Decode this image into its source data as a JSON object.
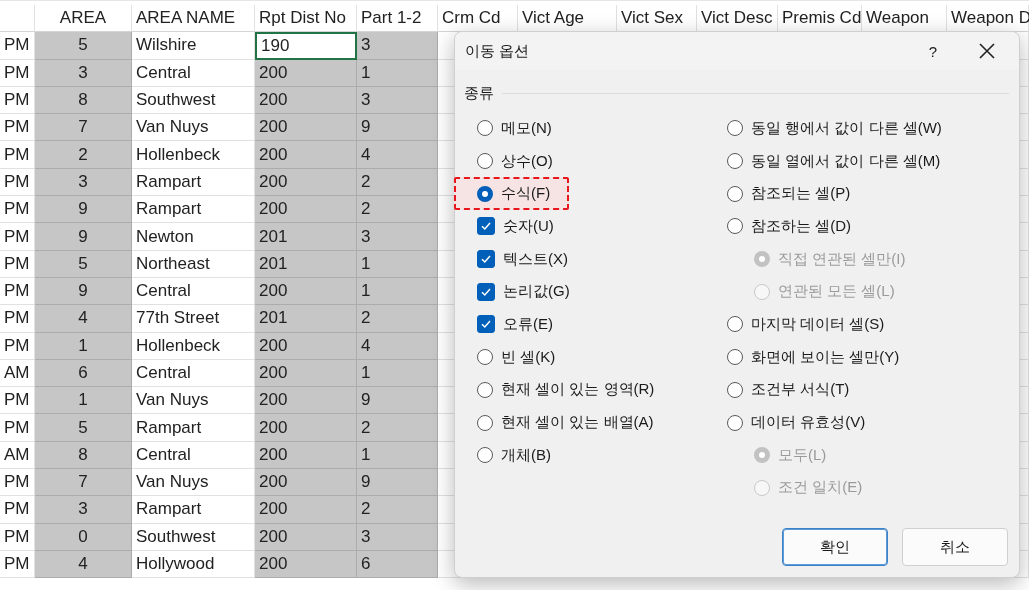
{
  "spreadsheet": {
    "columns": [
      {
        "selected": false
      },
      {
        "heading": "AREA",
        "selected": true
      },
      {
        "heading": "AREA NAME",
        "selected": false
      },
      {
        "heading": "Rpt Dist No",
        "selected": true
      },
      {
        "heading": "Part 1-2",
        "selected": true
      }
    ],
    "covered_columns": [
      {
        "heading": "Crm Cd"
      },
      {
        "heading": "Vict Age"
      },
      {
        "heading": "Vict Sex"
      },
      {
        "heading": "Vict Desc"
      },
      {
        "heading": "Premis Cd"
      },
      {
        "heading": "Weapon"
      },
      {
        "heading": "Weapon D"
      }
    ],
    "rows": [
      {
        "cells": [
          {
            "text": "PM",
            "active": false
          },
          {
            "text": "5",
            "active": false
          },
          {
            "text": "Wilshire",
            "active": false
          },
          {
            "text": "190",
            "active": true
          },
          {
            "text": "3",
            "active": false
          }
        ]
      },
      {
        "cells": [
          {
            "text": "PM",
            "active": false
          },
          {
            "text": "3",
            "active": false
          },
          {
            "text": "Central",
            "active": false
          },
          {
            "text": "200",
            "active": false
          },
          {
            "text": "1",
            "active": false
          }
        ]
      },
      {
        "cells": [
          {
            "text": "PM",
            "active": false
          },
          {
            "text": "8",
            "active": false
          },
          {
            "text": "Southwest",
            "active": false
          },
          {
            "text": "200",
            "active": false
          },
          {
            "text": "3",
            "active": false
          }
        ]
      },
      {
        "cells": [
          {
            "text": "PM",
            "active": false
          },
          {
            "text": "7",
            "active": false
          },
          {
            "text": "Van Nuys",
            "active": false
          },
          {
            "text": "200",
            "active": false
          },
          {
            "text": "9",
            "active": false
          }
        ]
      },
      {
        "cells": [
          {
            "text": "PM",
            "active": false
          },
          {
            "text": "2",
            "active": false
          },
          {
            "text": "Hollenbeck",
            "active": false
          },
          {
            "text": "200",
            "active": false
          },
          {
            "text": "4",
            "active": false
          }
        ]
      },
      {
        "cells": [
          {
            "text": "PM",
            "active": false
          },
          {
            "text": "3",
            "active": false
          },
          {
            "text": "Rampart",
            "active": false
          },
          {
            "text": "200",
            "active": false
          },
          {
            "text": "2",
            "active": false
          }
        ]
      },
      {
        "cells": [
          {
            "text": "PM",
            "active": false
          },
          {
            "text": "9",
            "active": false
          },
          {
            "text": "Rampart",
            "active": false
          },
          {
            "text": "200",
            "active": false
          },
          {
            "text": "2",
            "active": false
          }
        ]
      },
      {
        "cells": [
          {
            "text": "PM",
            "active": false
          },
          {
            "text": "9",
            "active": false
          },
          {
            "text": "Newton",
            "active": false
          },
          {
            "text": "201",
            "active": false
          },
          {
            "text": "3",
            "active": false
          }
        ]
      },
      {
        "cells": [
          {
            "text": "PM",
            "active": false
          },
          {
            "text": "5",
            "active": false
          },
          {
            "text": "Northeast",
            "active": false
          },
          {
            "text": "201",
            "active": false
          },
          {
            "text": "1",
            "active": false
          }
        ]
      },
      {
        "cells": [
          {
            "text": "PM",
            "active": false
          },
          {
            "text": "9",
            "active": false
          },
          {
            "text": "Central",
            "active": false
          },
          {
            "text": "200",
            "active": false
          },
          {
            "text": "1",
            "active": false
          }
        ]
      },
      {
        "cells": [
          {
            "text": "PM",
            "active": false
          },
          {
            "text": "4",
            "active": false
          },
          {
            "text": "77th Street",
            "active": false
          },
          {
            "text": "201",
            "active": false
          },
          {
            "text": "2",
            "active": false
          }
        ]
      },
      {
        "cells": [
          {
            "text": "PM",
            "active": false
          },
          {
            "text": "1",
            "active": false
          },
          {
            "text": "Hollenbeck",
            "active": false
          },
          {
            "text": "200",
            "active": false
          },
          {
            "text": "4",
            "active": false
          }
        ]
      },
      {
        "cells": [
          {
            "text": "AM",
            "active": false
          },
          {
            "text": "6",
            "active": false
          },
          {
            "text": "Central",
            "active": false
          },
          {
            "text": "200",
            "active": false
          },
          {
            "text": "1",
            "active": false
          }
        ]
      },
      {
        "cells": [
          {
            "text": "PM",
            "active": false
          },
          {
            "text": "1",
            "active": false
          },
          {
            "text": "Van Nuys",
            "active": false
          },
          {
            "text": "200",
            "active": false
          },
          {
            "text": "9",
            "active": false
          }
        ]
      },
      {
        "cells": [
          {
            "text": "PM",
            "active": false
          },
          {
            "text": "5",
            "active": false
          },
          {
            "text": "Rampart",
            "active": false
          },
          {
            "text": "200",
            "active": false
          },
          {
            "text": "2",
            "active": false
          }
        ]
      },
      {
        "cells": [
          {
            "text": "AM",
            "active": false
          },
          {
            "text": "8",
            "active": false
          },
          {
            "text": "Central",
            "active": false
          },
          {
            "text": "200",
            "active": false
          },
          {
            "text": "1",
            "active": false
          }
        ]
      },
      {
        "cells": [
          {
            "text": "PM",
            "active": false
          },
          {
            "text": "7",
            "active": false
          },
          {
            "text": "Van Nuys",
            "active": false
          },
          {
            "text": "200",
            "active": false
          },
          {
            "text": "9",
            "active": false
          }
        ]
      },
      {
        "cells": [
          {
            "text": "PM",
            "active": false
          },
          {
            "text": "3",
            "active": false
          },
          {
            "text": "Rampart",
            "active": false
          },
          {
            "text": "200",
            "active": false
          },
          {
            "text": "2",
            "active": false
          }
        ]
      },
      {
        "cells": [
          {
            "text": "PM",
            "active": false
          },
          {
            "text": "0",
            "active": false
          },
          {
            "text": "Southwest",
            "active": false
          },
          {
            "text": "200",
            "active": false
          },
          {
            "text": "3",
            "active": false
          }
        ]
      },
      {
        "cells": [
          {
            "text": "PM",
            "active": false
          },
          {
            "text": "4",
            "active": false
          },
          {
            "text": "Hollywood",
            "active": false
          },
          {
            "text": "200",
            "active": false
          },
          {
            "text": "6",
            "active": false
          }
        ]
      }
    ]
  },
  "dialog": {
    "title": "이동 옵션",
    "help": "?",
    "section": "종류",
    "left_options": [
      {
        "kind": "radio",
        "label": "메모(N)",
        "selected": false,
        "disabled": false,
        "highlighted": false
      },
      {
        "kind": "radio",
        "label": "상수(O)",
        "selected": false,
        "disabled": false,
        "highlighted": false
      },
      {
        "kind": "radio",
        "label": "수식(F)",
        "selected": true,
        "disabled": false,
        "highlighted": true,
        "children": [
          {
            "kind": "checkbox",
            "label": "숫자(U)",
            "checked": true,
            "disabled": false
          },
          {
            "kind": "checkbox",
            "label": "텍스트(X)",
            "checked": true,
            "disabled": false
          },
          {
            "kind": "checkbox",
            "label": "논리값(G)",
            "checked": true,
            "disabled": false
          },
          {
            "kind": "checkbox",
            "label": "오류(E)",
            "checked": true,
            "disabled": false
          }
        ]
      },
      {
        "kind": "radio",
        "label": "빈 셀(K)",
        "selected": false,
        "disabled": false,
        "highlighted": false
      },
      {
        "kind": "radio",
        "label": "현재 셀이 있는 영역(R)",
        "selected": false,
        "disabled": false,
        "highlighted": false
      },
      {
        "kind": "radio",
        "label": "현재 셀이 있는 배열(A)",
        "selected": false,
        "disabled": false,
        "highlighted": false
      },
      {
        "kind": "radio",
        "label": "개체(B)",
        "selected": false,
        "disabled": false,
        "highlighted": false
      }
    ],
    "right_options": [
      {
        "kind": "radio",
        "label": "동일 행에서 값이 다른 셀(W)",
        "selected": false,
        "disabled": false
      },
      {
        "kind": "radio",
        "label": "동일 열에서 값이 다른 셀(M)",
        "selected": false,
        "disabled": false
      },
      {
        "kind": "radio",
        "label": "참조되는 셀(P)",
        "selected": false,
        "disabled": false
      },
      {
        "kind": "radio",
        "label": "참조하는 셀(D)",
        "selected": false,
        "disabled": false,
        "children": [
          {
            "kind": "radio",
            "label": "직접 연관된 셀만(I)",
            "selected": true,
            "disabled": true
          },
          {
            "kind": "radio",
            "label": "연관된 모든 셀(L)",
            "selected": false,
            "disabled": true
          }
        ]
      },
      {
        "kind": "radio",
        "label": "마지막 데이터 셀(S)",
        "selected": false,
        "disabled": false
      },
      {
        "kind": "radio",
        "label": "화면에 보이는 셀만(Y)",
        "selected": false,
        "disabled": false
      },
      {
        "kind": "radio",
        "label": "조건부 서식(T)",
        "selected": false,
        "disabled": false
      },
      {
        "kind": "radio",
        "label": "데이터 유효성(V)",
        "selected": false,
        "disabled": false,
        "children": [
          {
            "kind": "radio",
            "label": "모두(L)",
            "selected": true,
            "disabled": true
          },
          {
            "kind": "radio",
            "label": "조건 일치(E)",
            "selected": false,
            "disabled": true
          }
        ]
      }
    ],
    "buttons": [
      {
        "label": "확인",
        "default": true
      },
      {
        "label": "취소",
        "default": false
      }
    ]
  }
}
